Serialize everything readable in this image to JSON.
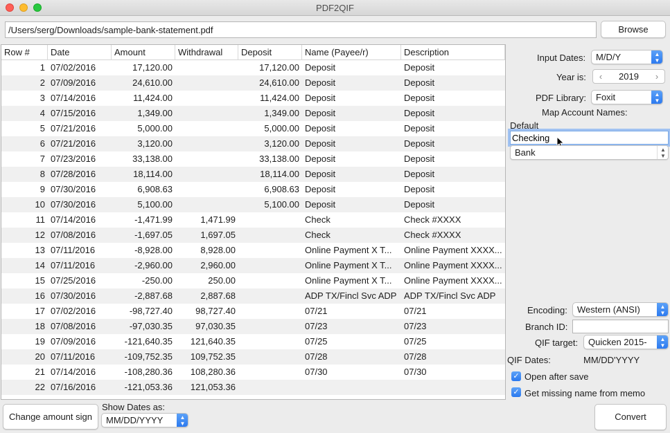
{
  "window": {
    "title": "PDF2QIF"
  },
  "file": {
    "path": "/Users/serg/Downloads/sample-bank-statement.pdf",
    "browse_label": "Browse"
  },
  "table": {
    "columns": [
      "Row #",
      "Date",
      "Amount",
      "Withdrawal",
      "Deposit",
      "Name (Payee/r)",
      "Description"
    ],
    "rows": [
      [
        "1",
        "07/02/2016",
        "17,120.00",
        "",
        "17,120.00",
        "Deposit",
        "Deposit"
      ],
      [
        "2",
        "07/09/2016",
        "24,610.00",
        "",
        "24,610.00",
        "Deposit",
        "Deposit"
      ],
      [
        "3",
        "07/14/2016",
        "11,424.00",
        "",
        "11,424.00",
        "Deposit",
        "Deposit"
      ],
      [
        "4",
        "07/15/2016",
        "1,349.00",
        "",
        "1,349.00",
        "Deposit",
        "Deposit"
      ],
      [
        "5",
        "07/21/2016",
        "5,000.00",
        "",
        "5,000.00",
        "Deposit",
        "Deposit"
      ],
      [
        "6",
        "07/21/2016",
        "3,120.00",
        "",
        "3,120.00",
        "Deposit",
        "Deposit"
      ],
      [
        "7",
        "07/23/2016",
        "33,138.00",
        "",
        "33,138.00",
        "Deposit",
        "Deposit"
      ],
      [
        "8",
        "07/28/2016",
        "18,114.00",
        "",
        "18,114.00",
        "Deposit",
        "Deposit"
      ],
      [
        "9",
        "07/30/2016",
        "6,908.63",
        "",
        "6,908.63",
        "Deposit",
        "Deposit"
      ],
      [
        "10",
        "07/30/2016",
        "5,100.00",
        "",
        "5,100.00",
        "Deposit",
        "Deposit"
      ],
      [
        "11",
        "07/14/2016",
        "-1,471.99",
        "1,471.99",
        "",
        "Check",
        "Check #XXXX"
      ],
      [
        "12",
        "07/08/2016",
        "-1,697.05",
        "1,697.05",
        "",
        "Check",
        "Check #XXXX"
      ],
      [
        "13",
        "07/11/2016",
        "-8,928.00",
        "8,928.00",
        "",
        "Online Payment X T...",
        "Online Payment XXXX..."
      ],
      [
        "14",
        "07/11/2016",
        "-2,960.00",
        "2,960.00",
        "",
        "Online Payment X T...",
        "Online Payment XXXX..."
      ],
      [
        "15",
        "07/25/2016",
        "-250.00",
        "250.00",
        "",
        "Online Payment X T...",
        "Online Payment XXXX..."
      ],
      [
        "16",
        "07/30/2016",
        "-2,887.68",
        "2,887.68",
        "",
        "ADP TX/Fincl Svc ADP",
        "ADP TX/Fincl Svc ADP"
      ],
      [
        "17",
        "07/02/2016",
        "-98,727.40",
        "98,727.40",
        "",
        "07/21",
        "07/21"
      ],
      [
        "18",
        "07/08/2016",
        "-97,030.35",
        "97,030.35",
        "",
        "07/23",
        "07/23"
      ],
      [
        "19",
        "07/09/2016",
        "-121,640.35",
        "121,640.35",
        "",
        "07/25",
        "07/25"
      ],
      [
        "20",
        "07/11/2016",
        "-109,752.35",
        "109,752.35",
        "",
        "07/28",
        "07/28"
      ],
      [
        "21",
        "07/14/2016",
        "-108,280.36",
        "108,280.36",
        "",
        "07/30",
        "07/30"
      ],
      [
        "22",
        "07/16/2016",
        "-121,053.36",
        "121,053.36",
        "",
        "",
        ""
      ]
    ]
  },
  "settings": {
    "input_dates_label": "Input Dates:",
    "input_dates_value": "M/D/Y",
    "year_label": "Year is:",
    "year_value": "2019",
    "pdf_library_label": "PDF Library:",
    "pdf_library_value": "Foxit",
    "map_accounts_label": "Map Account Names:",
    "default_label": "Default",
    "account_name": "Checking",
    "account_type": "Bank",
    "encoding_label": "Encoding:",
    "encoding_value": "Western (ANSI)",
    "branch_label": "Branch ID:",
    "branch_value": "",
    "qif_target_label": "QIF target:",
    "qif_target_value": "Quicken 2015-",
    "qif_dates_label": "QIF Dates:",
    "qif_dates_value": "MM/DD'YYYY",
    "open_after_save": "Open after save",
    "get_missing_name": "Get missing name from memo"
  },
  "bottom": {
    "change_sign_label": "Change amount sign",
    "show_dates_label": "Show Dates as:",
    "show_dates_value": "MM/DD/YYYY",
    "convert_label": "Convert"
  },
  "colors": {
    "accent": "#2a78ef",
    "row_alt": "#f0f0f0"
  }
}
